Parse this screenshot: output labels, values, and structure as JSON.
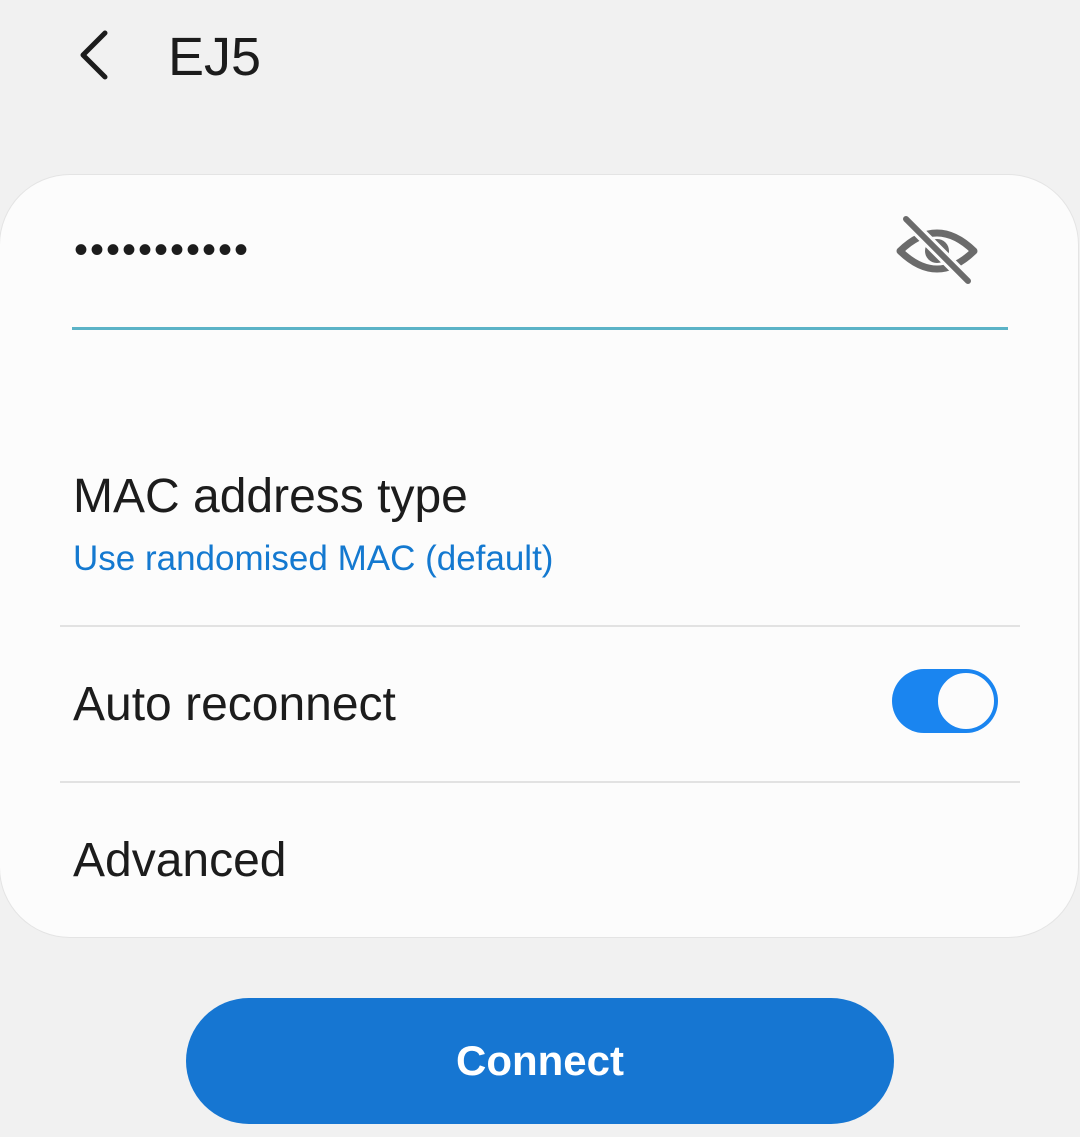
{
  "header": {
    "back_icon": "chevron-left-icon",
    "title": "EJ5"
  },
  "password": {
    "value": "•••••••••••",
    "visibility_icon": "eye-off-icon"
  },
  "settings": {
    "mac": {
      "label": "MAC address type",
      "value": "Use randomised MAC (default)"
    },
    "auto_reconnect": {
      "label": "Auto reconnect",
      "enabled": true
    },
    "advanced": {
      "label": "Advanced"
    }
  },
  "connect_button": {
    "label": "Connect"
  },
  "colors": {
    "accent": "#1676d2",
    "toggle_on": "#1a85f0",
    "link": "#1479d0",
    "field_underline": "#5bb3c7"
  }
}
